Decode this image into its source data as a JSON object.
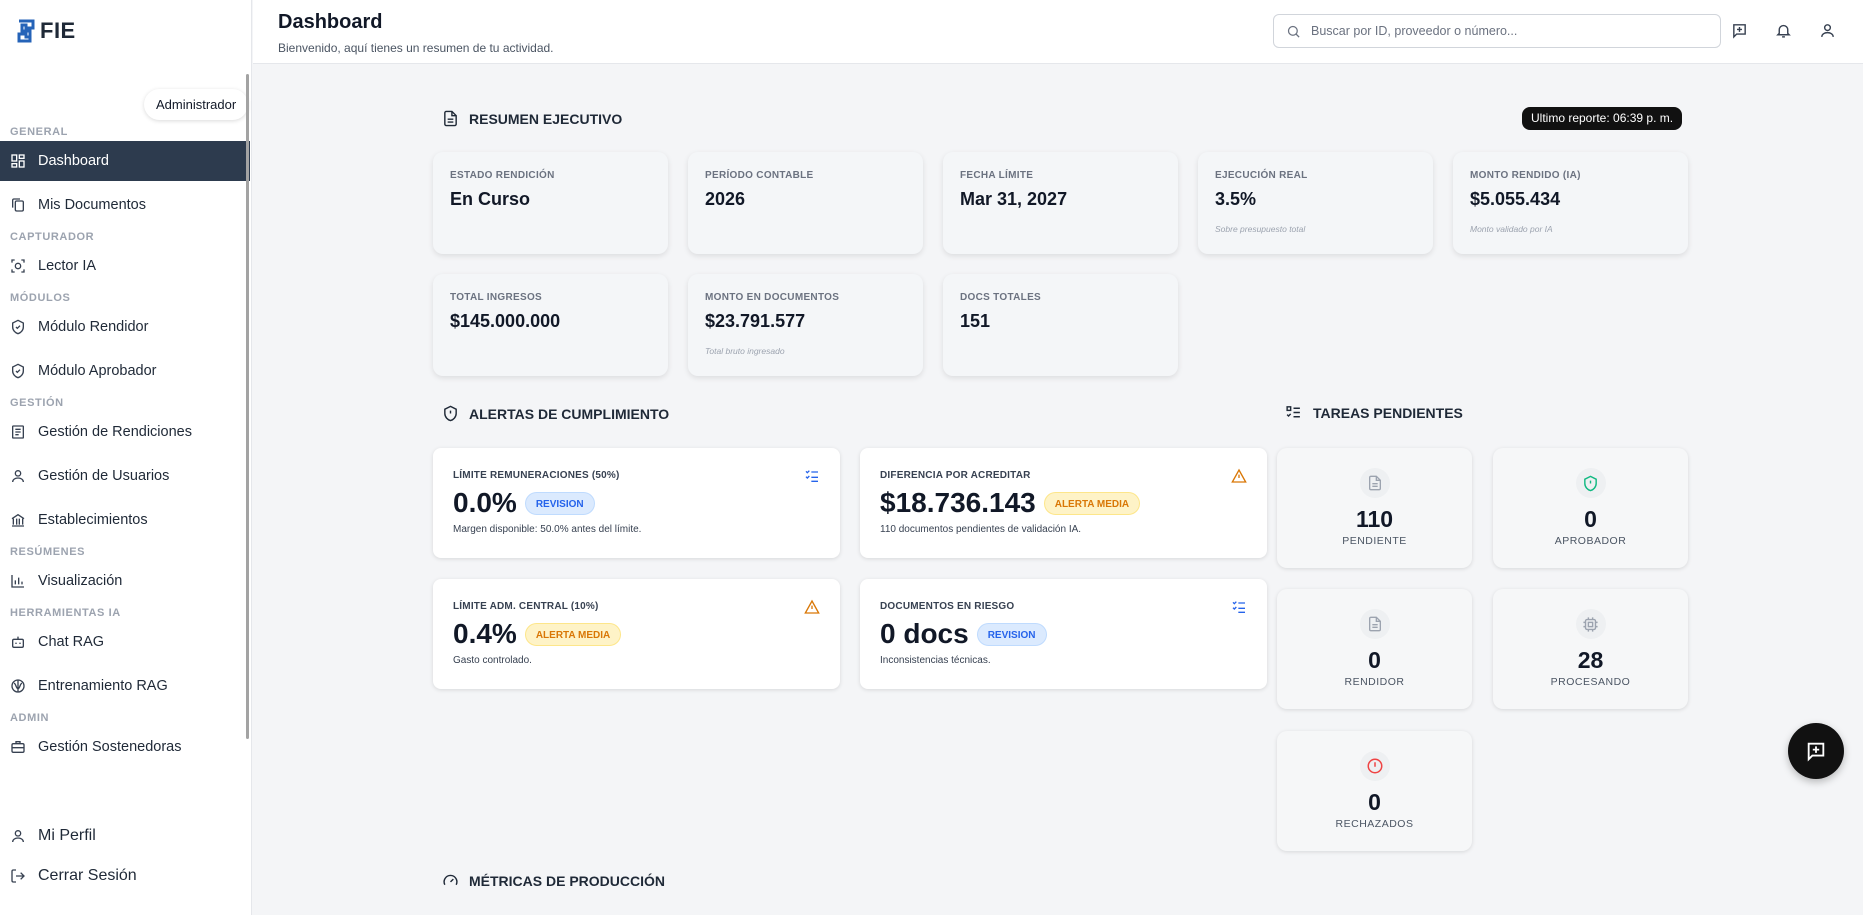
{
  "app": {
    "brand": "FIE",
    "role": "Administrador"
  },
  "sidebar": {
    "sections": [
      {
        "title": "GENERAL",
        "items": [
          {
            "label": "Dashboard",
            "icon": "grid-icon",
            "active": true
          },
          {
            "label": "Mis Documentos",
            "icon": "documents-icon"
          }
        ]
      },
      {
        "title": "CAPTURADOR",
        "items": [
          {
            "label": "Lector IA",
            "icon": "scan-icon"
          }
        ]
      },
      {
        "title": "MÓDULOS",
        "items": [
          {
            "label": "Módulo Rendidor",
            "icon": "shield-check-icon"
          },
          {
            "label": "Módulo Aprobador",
            "icon": "shield-check-icon"
          }
        ]
      },
      {
        "title": "GESTIÓN",
        "items": [
          {
            "label": "Gestión de Rendiciones",
            "icon": "receipt-icon"
          },
          {
            "label": "Gestión de Usuarios",
            "icon": "user-icon"
          },
          {
            "label": "Establecimientos",
            "icon": "bank-icon"
          }
        ]
      },
      {
        "title": "RESÚMENES",
        "items": [
          {
            "label": "Visualización",
            "icon": "bar-chart-icon"
          }
        ]
      },
      {
        "title": "HERRAMIENTAS IA",
        "items": [
          {
            "label": "Chat RAG",
            "icon": "bot-icon"
          },
          {
            "label": "Entrenamiento RAG",
            "icon": "brain-icon"
          }
        ]
      },
      {
        "title": "ADMIN",
        "items": [
          {
            "label": "Gestión Sostenedoras",
            "icon": "briefcase-icon"
          }
        ]
      }
    ],
    "bottom": {
      "profile": "Mi Perfil",
      "logout": "Cerrar Sesión"
    }
  },
  "header": {
    "title": "Dashboard",
    "subtitle": "Bienvenido, aquí tienes un resumen de tu actividad.",
    "search_placeholder": "Buscar por ID, proveedor o número..."
  },
  "summary": {
    "title": "RESUMEN EJECUTIVO",
    "report_badge": "Ultimo reporte: 06:39 p. m.",
    "kpis": [
      {
        "label": "ESTADO RENDICIÓN",
        "value": "En Curso",
        "note": ""
      },
      {
        "label": "PERÍODO CONTABLE",
        "value": "2026",
        "note": ""
      },
      {
        "label": "FECHA LÍMITE",
        "value": "Mar 31, 2027",
        "note": ""
      },
      {
        "label": "EJECUCIÓN REAL",
        "value": "3.5%",
        "note": "Sobre presupuesto total"
      },
      {
        "label": "MONTO RENDIDO (IA)",
        "value": "$5.055.434",
        "note": "Monto validado por IA"
      },
      {
        "label": "TOTAL INGRESOS",
        "value": "$145.000.000",
        "note": ""
      },
      {
        "label": "MONTO EN DOCUMENTOS",
        "value": "$23.791.577",
        "note": "Total bruto ingresado"
      },
      {
        "label": "DOCS TOTALES",
        "value": "151",
        "note": ""
      }
    ]
  },
  "alerts": {
    "title": "ALERTAS DE CUMPLIMIENTO",
    "items": [
      {
        "label": "LÍMITE REMUNERACIONES (50%)",
        "value": "0.0%",
        "badge": "REVISION",
        "desc": "Margen disponible: 50.0% antes del límite.",
        "icon": "list-check-icon"
      },
      {
        "label": "DIFERENCIA POR ACREDITAR",
        "value": "$18.736.143",
        "badge": "ALERTA MEDIA",
        "desc": "110 documentos pendientes de validación IA.",
        "icon": "warning-icon"
      },
      {
        "label": "LÍMITE ADM. CENTRAL (10%)",
        "value": "0.4%",
        "badge": "ALERTA MEDIA",
        "desc": "Gasto controlado.",
        "icon": "warning-icon"
      },
      {
        "label": "DOCUMENTOS EN RIESGO",
        "value": "0 docs",
        "badge": "REVISION",
        "desc": "Inconsistencias técnicas.",
        "icon": "list-check-icon"
      }
    ]
  },
  "tasks": {
    "title": "TAREAS PENDIENTES",
    "items": [
      {
        "value": "110",
        "label": "PENDIENTE",
        "icon": "file-icon",
        "color": "#9ca3af"
      },
      {
        "value": "0",
        "label": "APROBADOR",
        "icon": "shield-check-icon",
        "color": "#10b981"
      },
      {
        "value": "0",
        "label": "RENDIDOR",
        "icon": "file-icon",
        "color": "#9ca3af"
      },
      {
        "value": "28",
        "label": "PROCESANDO",
        "icon": "cpu-icon",
        "color": "#9ca3af"
      },
      {
        "value": "0",
        "label": "RECHAZADOS",
        "icon": "alert-circle-icon",
        "color": "#ef4444"
      }
    ]
  },
  "metrics": {
    "title": "MÉTRICAS DE PRODUCCIÓN"
  },
  "colors": {
    "sidebar_active": "#2d3b4e",
    "info": "#2563eb",
    "warning": "#d97706",
    "success": "#10b981",
    "danger": "#ef4444"
  }
}
